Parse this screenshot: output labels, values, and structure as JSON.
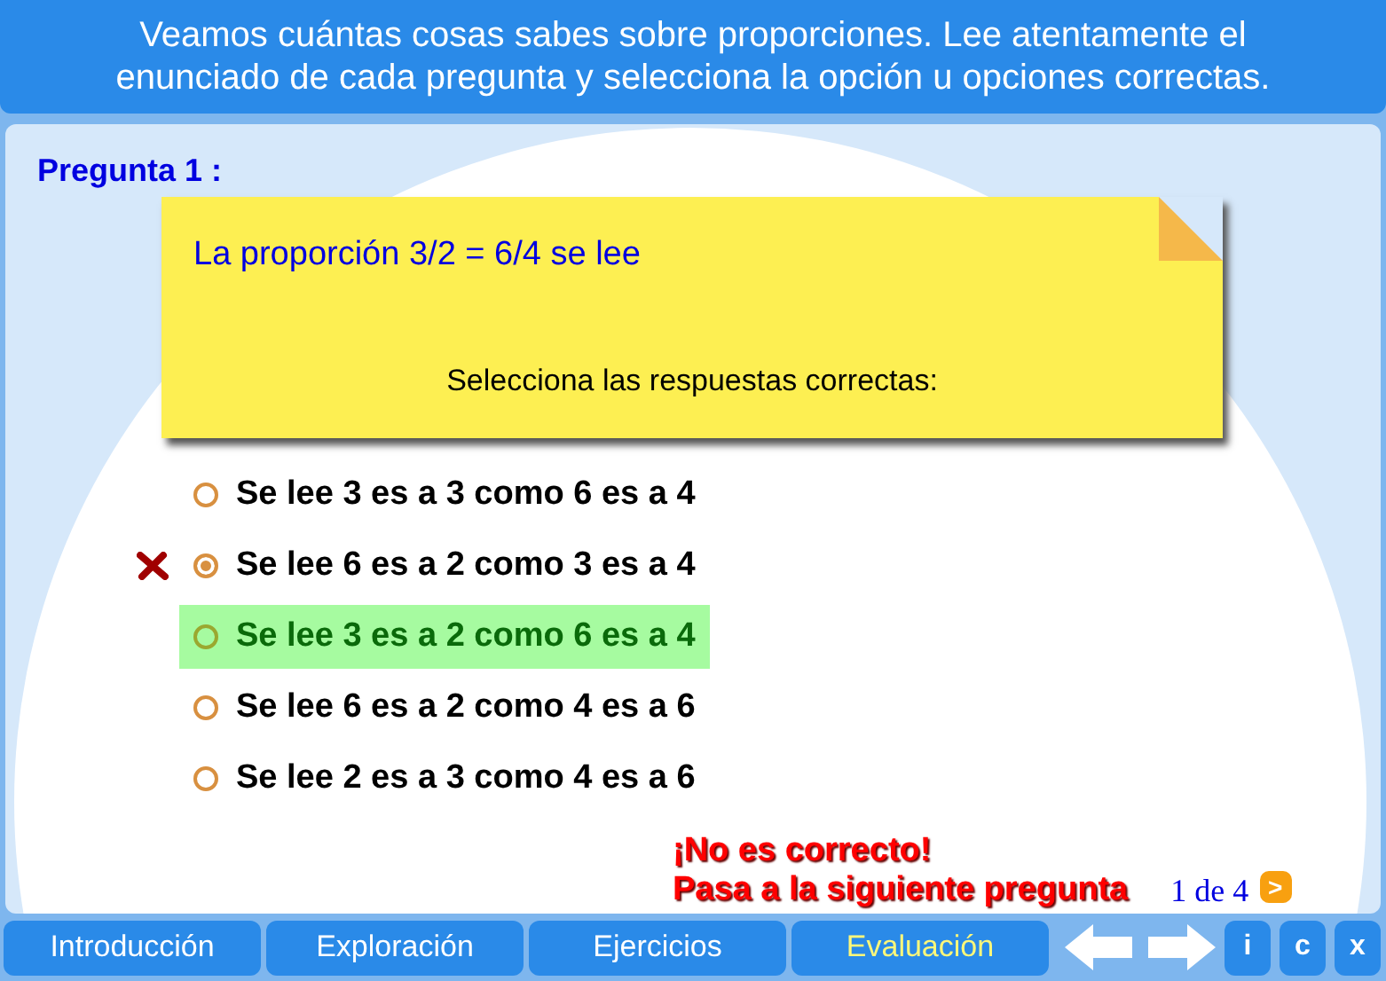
{
  "header": {
    "instructions": "Veamos cuántas cosas sabes sobre proporciones. Lee atentamente el enunciado de cada pregunta y selecciona la opción u opciones correctas."
  },
  "question": {
    "label": "Pregunta 1 :",
    "statement": "La proporción 3/2 = 6/4 se lee",
    "prompt": "Selecciona las respuestas correctas:"
  },
  "options": [
    {
      "text": "Se lee 3 es a 3 como 6 es a 4",
      "selected": false,
      "marked_wrong": false,
      "correct": false
    },
    {
      "text": "Se lee 6 es a 2 como 3 es a 4",
      "selected": true,
      "marked_wrong": true,
      "correct": false
    },
    {
      "text": "Se lee 3 es a 2 como 6 es a 4",
      "selected": false,
      "marked_wrong": false,
      "correct": true
    },
    {
      "text": "Se lee 6 es a 2 como 4 es a 6",
      "selected": false,
      "marked_wrong": false,
      "correct": false
    },
    {
      "text": "Se lee 2 es a 3 como 4 es a 6",
      "selected": false,
      "marked_wrong": false,
      "correct": false
    }
  ],
  "feedback": [
    "¡No es correcto!",
    "Pasa a la siguiente pregunta"
  ],
  "pager": {
    "text": "1 de 4",
    "next": ">"
  },
  "tabs": [
    {
      "label": "Introducción",
      "selected": false
    },
    {
      "label": "Exploración",
      "selected": false
    },
    {
      "label": "Ejercicios",
      "selected": false
    },
    {
      "label": "Evaluación",
      "selected": true
    }
  ],
  "tool_buttons": [
    "i",
    "c",
    "x"
  ]
}
